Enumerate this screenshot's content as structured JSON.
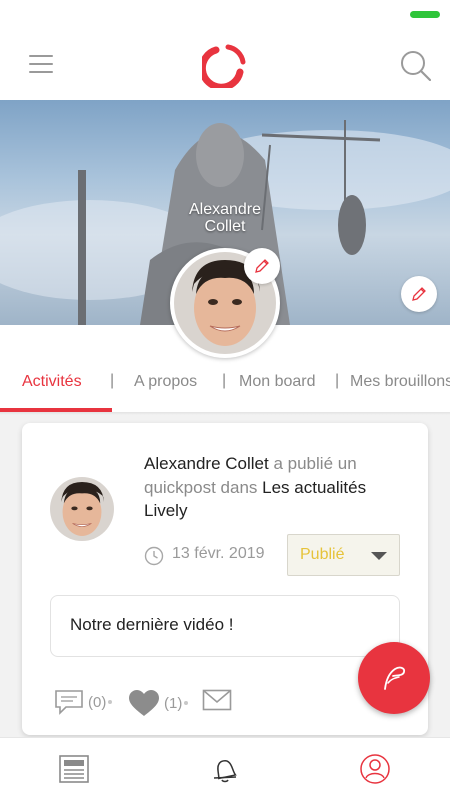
{
  "cover": {
    "name_line1": "Alexandre",
    "name_line2": "Collet"
  },
  "tabs": [
    {
      "label": "Activités"
    },
    {
      "label": "A propos"
    },
    {
      "label": "Mon board"
    },
    {
      "label": "Mes brouillons"
    }
  ],
  "tab_separator": "|",
  "post": {
    "author": "Alexandre Collet",
    "text1": " a publié un quickpost dans ",
    "group": "Les actualités Lively",
    "date": "13 févr. 2019",
    "status": "Publié",
    "content": "Notre dernière vidéo !",
    "comments_count": "(0)",
    "likes_count": "(1)"
  },
  "colors": {
    "accent": "#e8343f",
    "status_text": "#e6c33a",
    "battery": "#2fc53a"
  },
  "icons": {
    "menu": "hamburger-menu-icon",
    "search": "search-icon",
    "edit": "pencil-icon",
    "clock": "clock-icon",
    "comment": "comment-icon",
    "like": "heart-icon",
    "share": "envelope-icon",
    "fab": "quill-icon",
    "nav": [
      "newspaper-icon",
      "bell-icon",
      "user-icon"
    ]
  }
}
